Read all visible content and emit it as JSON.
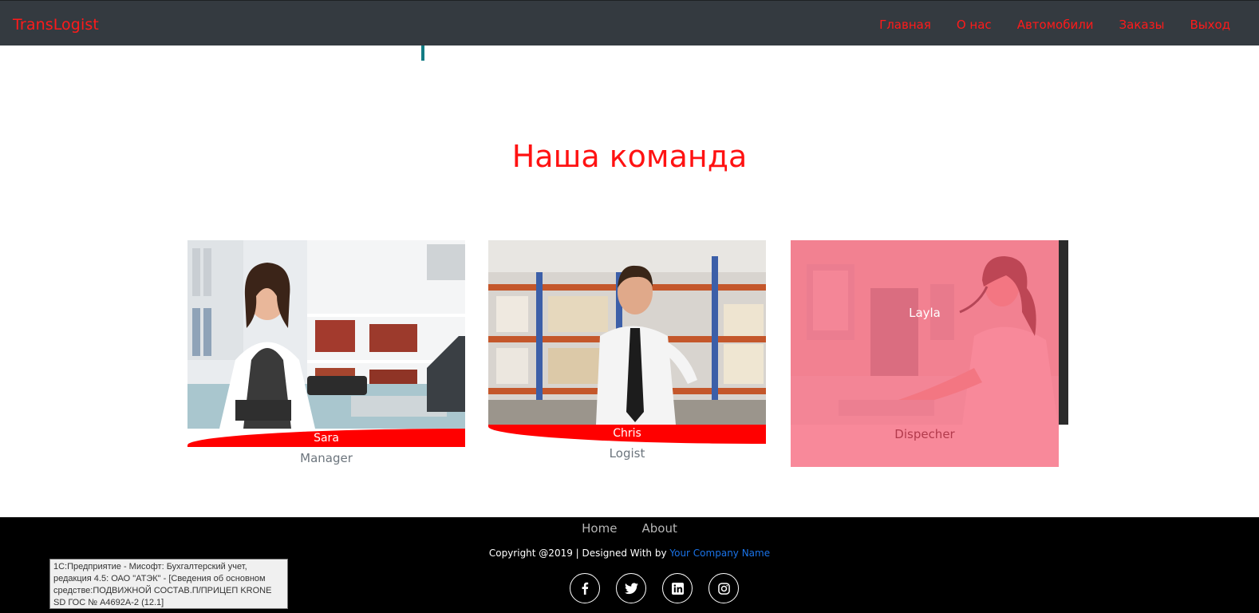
{
  "navbar": {
    "brand": "TransLogist",
    "links": [
      "Главная",
      "О нас",
      "Автомобили",
      "Заказы",
      "Выход"
    ]
  },
  "team": {
    "title": "Наша команда",
    "members": [
      {
        "name": "Sara",
        "role": "Manager"
      },
      {
        "name": "Chris",
        "role": "Logist"
      },
      {
        "name": "Layla",
        "role": "Dispecher"
      }
    ]
  },
  "footer": {
    "links": [
      "Home",
      "About"
    ],
    "copyright_prefix": "Copyright @2019 | Designed With by",
    "company": "Your Company Name",
    "socials": [
      "facebook-icon",
      "twitter-icon",
      "linkedin-icon",
      "instagram-icon"
    ]
  },
  "tooltip": {
    "text": "1С:Предприятие - Мисофт: Бухгалтерский учет, редакция 4.5: ОАО \"АТЭК\" - [Сведения об основном средстве:ПОДВИЖНОЙ СОСТАВ.П/ПРИЦЕП KRONE SD ГОС № А4692А-2 (12.1]"
  },
  "colors": {
    "navbar_bg": "#343a40",
    "accent_red": "#ff0000",
    "footer_bg": "#000000",
    "link_blue": "#1a73e8"
  }
}
